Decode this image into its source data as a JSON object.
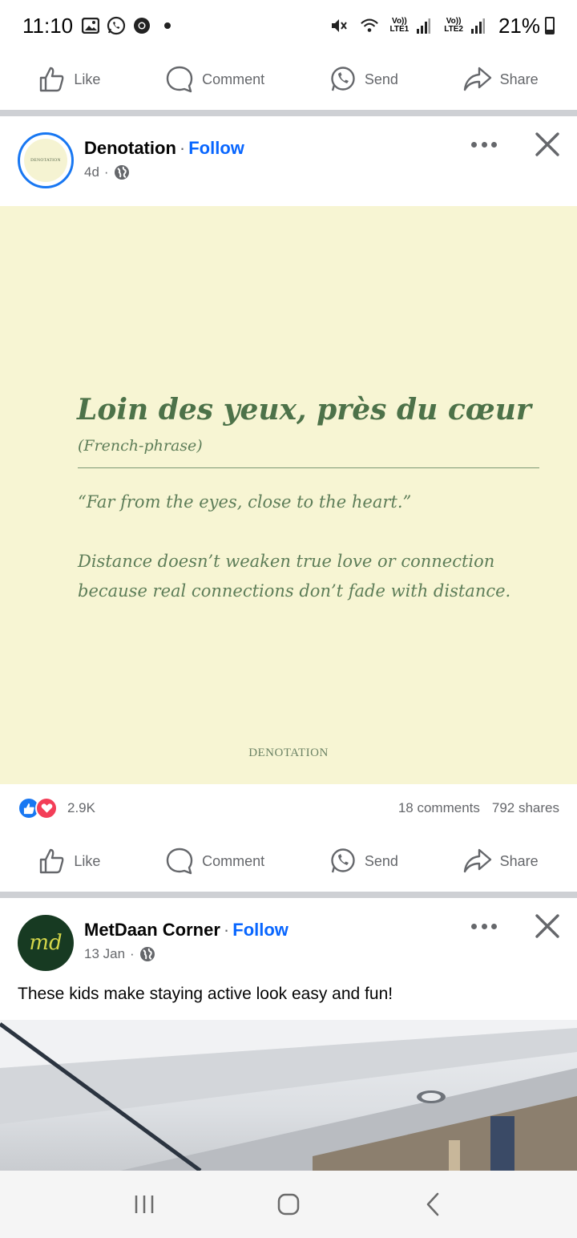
{
  "status_bar": {
    "time": "11:10",
    "network1": "Vo))\nLTE1",
    "network2": "Vo))\nLTE2",
    "battery": "21%"
  },
  "top_actions": {
    "like": "Like",
    "comment": "Comment",
    "send": "Send",
    "share": "Share"
  },
  "post1": {
    "page_name": "Denotation",
    "follow": "Follow",
    "time": "4d",
    "avatar_text": "DENOTATION",
    "quote": {
      "title": "Loin des yeux, près du cœur",
      "subtitle": "(French-phrase)",
      "translation": "“Far from the eyes, close to the heart.”",
      "body_line1": "Distance doesn’t weaken true love or connection",
      "body_line2": "because real connections don’t fade with distance.",
      "brand": "DENOTATION"
    },
    "reactions_count": "2.9K",
    "comments": "18 comments",
    "shares": "792 shares",
    "actions": {
      "like": "Like",
      "comment": "Comment",
      "send": "Send",
      "share": "Share"
    }
  },
  "post2": {
    "page_name": "MetDaan Corner",
    "follow": "Follow",
    "time": "13 Jan",
    "avatar_text": "md",
    "caption": "These kids make staying active look easy and fun!"
  },
  "colors": {
    "facebook_blue": "#0866ff",
    "quote_green": "#4d7249",
    "quote_bg": "#f7f5d3"
  }
}
